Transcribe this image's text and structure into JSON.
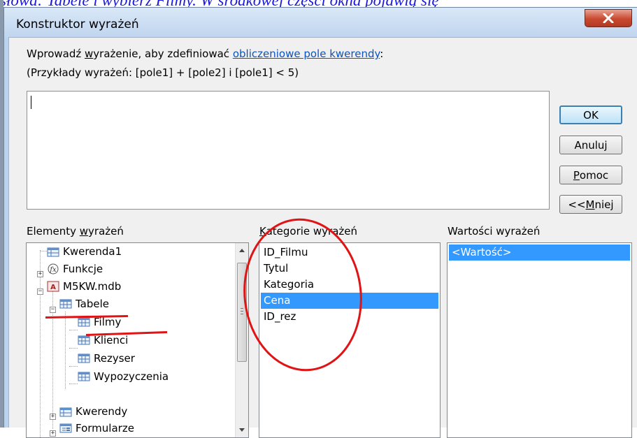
{
  "caption": "słowa: Tabele i wybierz Filmy. W środkowej części okna pojawią się",
  "window": {
    "title": "Konstruktor wyrażeń"
  },
  "prompt": {
    "text_before": "Wprowadź ",
    "underlined": "w",
    "text_middle": "yrażenie, aby zdefiniować ",
    "link": "obliczeniowe pole kwerendy",
    "text_after": ":"
  },
  "examples": "(Przykłady wyrażeń: [pole1] + [pole2] i [pole1] < 5)",
  "expression_value": "",
  "buttons": {
    "ok": "OK",
    "cancel": "Anuluj",
    "help_mnemonic": "P",
    "help_rest": "omoc",
    "less_prefix": "<< ",
    "less_mnemonic": "M",
    "less_rest": "niej"
  },
  "elements": {
    "label_before": "Elementy ",
    "label_mnemonic": "w",
    "label_after": "yrażeń",
    "tree": [
      {
        "label": "Kwerenda1",
        "icon": "query-icon"
      },
      {
        "label": "Funkcje",
        "icon": "function-icon"
      },
      {
        "label": "M5KW.mdb",
        "icon": "database-icon"
      },
      {
        "label": "Tabele",
        "icon": "tables-icon"
      },
      {
        "label": "Filmy",
        "icon": "table-icon"
      },
      {
        "label": "Klienci",
        "icon": "table-icon"
      },
      {
        "label": "Rezyser",
        "icon": "table-icon"
      },
      {
        "label": "Wypozyczenia",
        "icon": "table-icon"
      },
      {
        "label": "Kwerendy",
        "icon": "query-icon"
      },
      {
        "label": "Formularze",
        "icon": "form-icon"
      }
    ]
  },
  "categories": {
    "label_mnemonic": "K",
    "label_rest": "ategorie wyrażeń",
    "items": [
      "ID_Filmu",
      "Tytul",
      "Kategoria",
      "Cena",
      "ID_rez"
    ],
    "selected_index": 3
  },
  "values": {
    "label": "Wartości wyrażeń",
    "items": [
      "<Wartość>"
    ]
  },
  "colors": {
    "selection": "#3399ff",
    "annotation": "#e01414",
    "link": "#0b53c3"
  }
}
